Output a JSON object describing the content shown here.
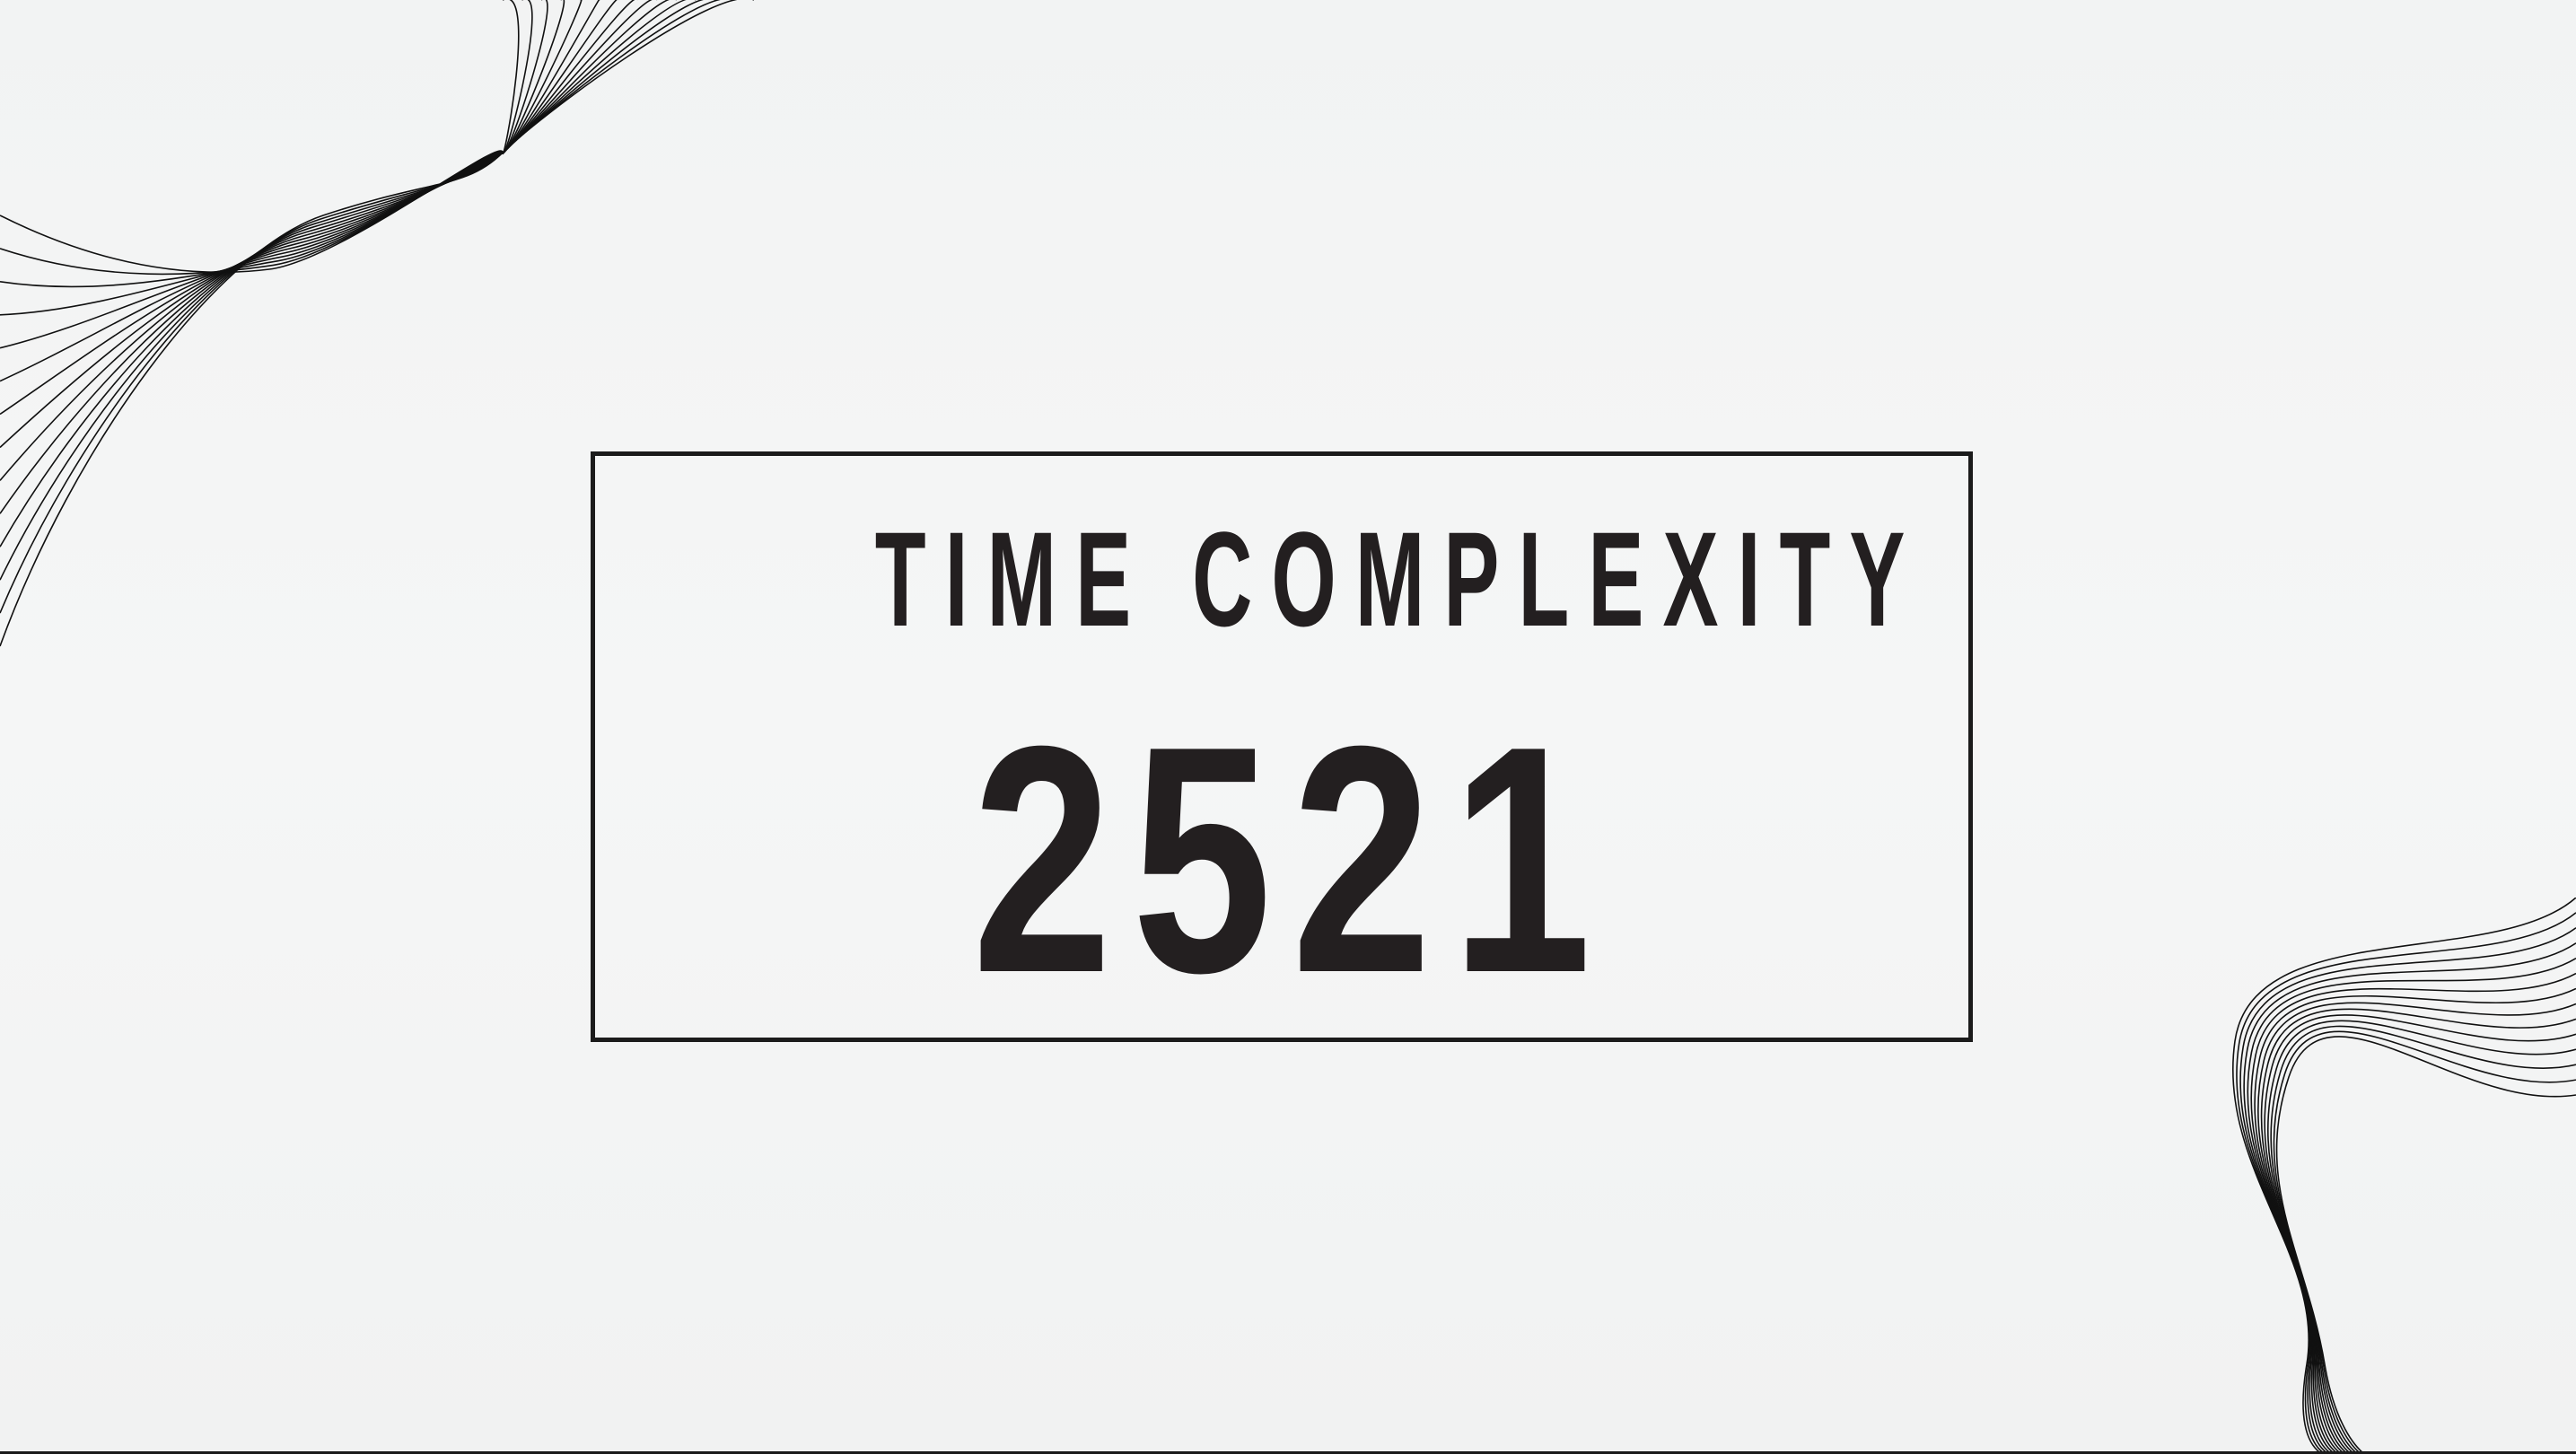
{
  "slide": {
    "title": "TIME COMPLEXITY",
    "number": "2521"
  },
  "colors": {
    "background": "#f3f4f4",
    "text": "#231f20",
    "border": "#1b1b1b",
    "line_art": "#111111"
  },
  "decorations": {
    "top_left": "wave-lines-graphic",
    "bottom_right": "wave-lines-graphic"
  }
}
